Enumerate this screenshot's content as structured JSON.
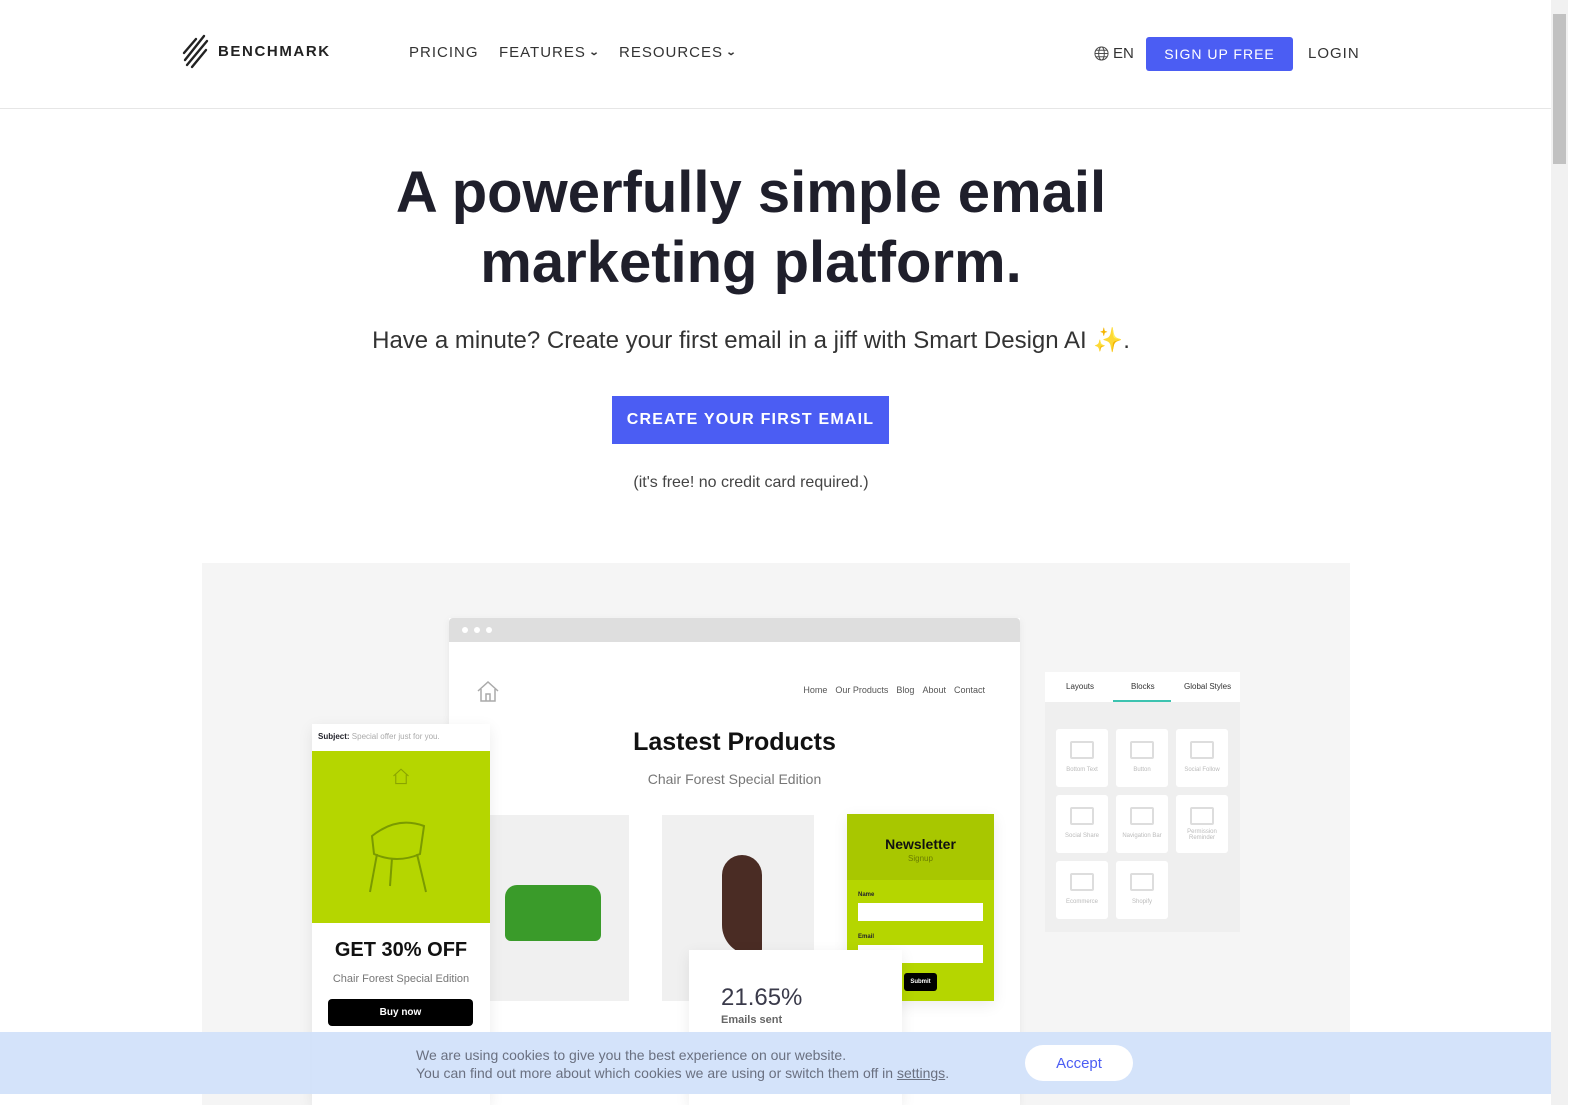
{
  "header": {
    "brand": "BENCHMARK",
    "nav": [
      {
        "label": "PRICING"
      },
      {
        "label": "FEATURES",
        "dropdown": true
      },
      {
        "label": "RESOURCES",
        "dropdown": true
      }
    ],
    "language": "EN",
    "signup_label": "SIGN UP FREE",
    "login_label": "LOGIN"
  },
  "hero": {
    "title_line1": "A powerfully simple email",
    "title_line2": "marketing platform.",
    "subtitle": "Have a minute? Create your first email in a jiff with Smart Design AI",
    "sparkle": "✨",
    "period": ".",
    "cta_label": "CREATE YOUR FIRST EMAIL",
    "note": "(it's free! no credit card required.)"
  },
  "mockup": {
    "nav": [
      "Home",
      "Our Products",
      "Blog",
      "About",
      "Contact"
    ],
    "title": "Lastest Products",
    "subtitle": "Chair Forest Special Edition",
    "email_card": {
      "subject_label": "Subject:",
      "subject": "Special offer just for you.",
      "headline": "GET 30% OFF",
      "caption": "Chair Forest Special Edition",
      "button": "Buy now"
    },
    "newsletter": {
      "title": "Newsletter",
      "subtitle": "Signup",
      "name_label": "Name",
      "email_label": "Email",
      "submit": "Submit"
    },
    "stat": {
      "value": "21.65%",
      "label": "Emails sent"
    },
    "panel": {
      "tabs": [
        "Layouts",
        "Blocks",
        "Global Styles"
      ],
      "active_tab": "Blocks",
      "accent": "#3cc3b0",
      "blocks": [
        "Bottom Text",
        "Button",
        "Social Follow",
        "Social Share",
        "Navigation Bar",
        "Permission Reminder",
        "Ecommerce",
        "Shopify"
      ]
    }
  },
  "cookie": {
    "line1": "We are using cookies to give you the best experience on our website.",
    "line2_prefix": "You can find out more about which cookies we are using or switch them off in ",
    "settings_link": "settings",
    "line2_suffix": ".",
    "accept_label": "Accept"
  },
  "colors": {
    "primary": "#4b5df3",
    "lime": "#b5d600",
    "cookie_bg": "#d2e2fa"
  }
}
